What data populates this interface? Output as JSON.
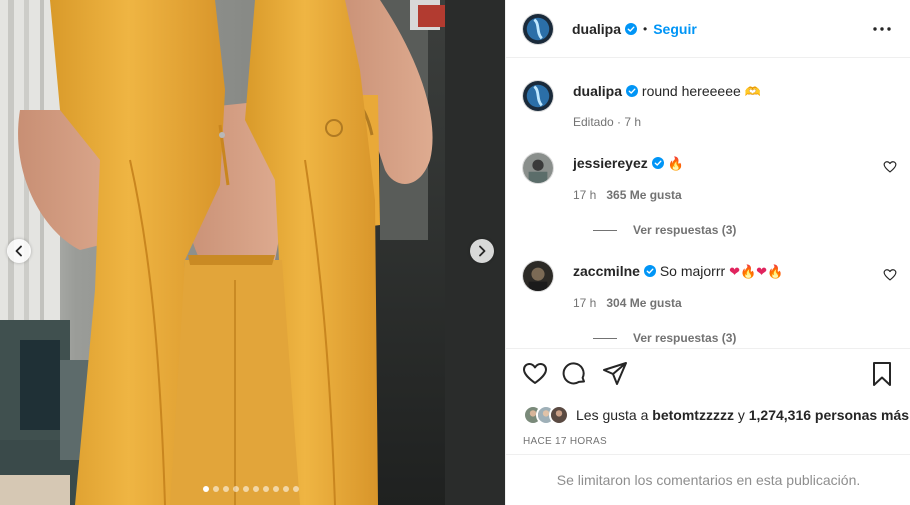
{
  "post": {
    "username": "dualipa",
    "follow_label": "Seguir",
    "separator": "•",
    "more_icon": "more-horizontal-icon",
    "caption_text": "round hereeeee",
    "caption_emoji": "🫶",
    "caption_meta": "Editado · 7 h",
    "carousel": {
      "slide_count": 10,
      "active_index": 0
    }
  },
  "comments": [
    {
      "username": "jessiereyez",
      "text": "",
      "emojis": [
        "🔥"
      ],
      "age": "17 h",
      "likes": "365 Me gusta",
      "replies": "Ver respuestas (3)"
    },
    {
      "username": "zaccmilne",
      "text": "So majorrr ",
      "emojis": [
        "❤",
        "🔥",
        "❤",
        "🔥"
      ],
      "age": "17 h",
      "likes": "304 Me gusta",
      "replies": "Ver respuestas (3)"
    }
  ],
  "actions": {
    "icons": [
      "heart-icon",
      "comment-icon",
      "share-icon",
      "bookmark-icon"
    ],
    "likes_prefix": "Les gusta a ",
    "likes_user": "betomtzzzzz",
    "likes_mid": " y ",
    "likes_count": "1,274,316 personas más",
    "timestamp": "HACE 17 HORAS"
  },
  "footer": {
    "limited_text": "Se limitaron los comentarios en esta publicación."
  },
  "colors": {
    "accent": "#0095f6",
    "outfit": "#e8a838",
    "text": "#262626",
    "muted": "#737373"
  }
}
